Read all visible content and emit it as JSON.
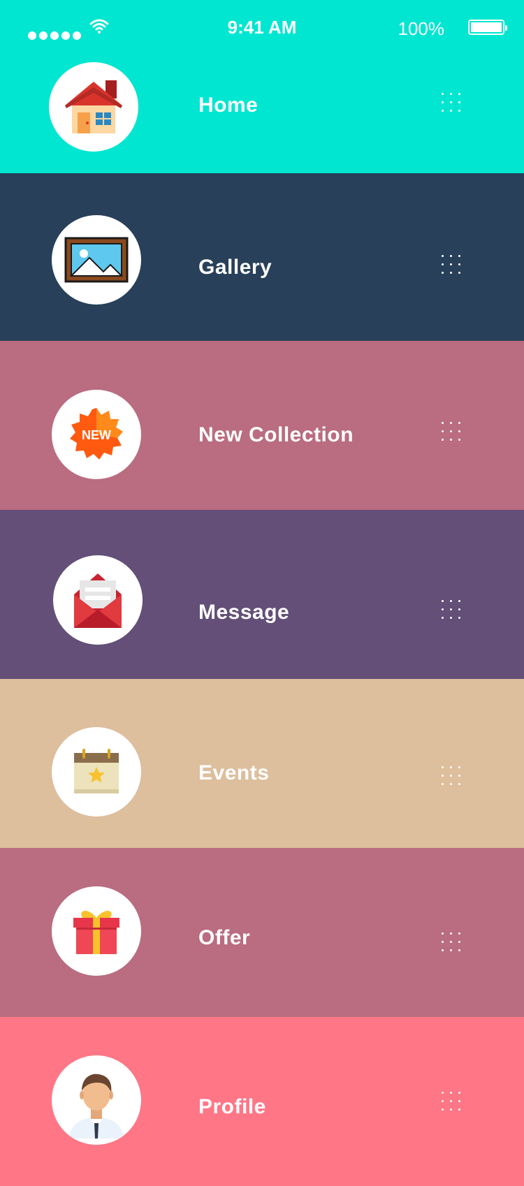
{
  "status_bar": {
    "time": "9:41 AM",
    "battery": "100%",
    "wifi_icon": "wifi-icon",
    "signal_icon": "signal-dots-icon"
  },
  "menu": {
    "items": [
      {
        "label": "Home",
        "icon": "house-icon",
        "color": "#00e6d0"
      },
      {
        "label": "Gallery",
        "icon": "picture-frame-icon",
        "color": "#284059"
      },
      {
        "label": "New Collection",
        "icon": "new-badge-icon",
        "color": "#ba6c80",
        "badge": "NEW"
      },
      {
        "label": "Message",
        "icon": "envelope-icon",
        "color": "#634f77"
      },
      {
        "label": "Events",
        "icon": "calendar-star-icon",
        "color": "#ddbe9d"
      },
      {
        "label": "Offer",
        "icon": "gift-icon",
        "color": "#ba6c80"
      },
      {
        "label": "Profile",
        "icon": "user-avatar-icon",
        "color": "#ff7686"
      }
    ]
  }
}
